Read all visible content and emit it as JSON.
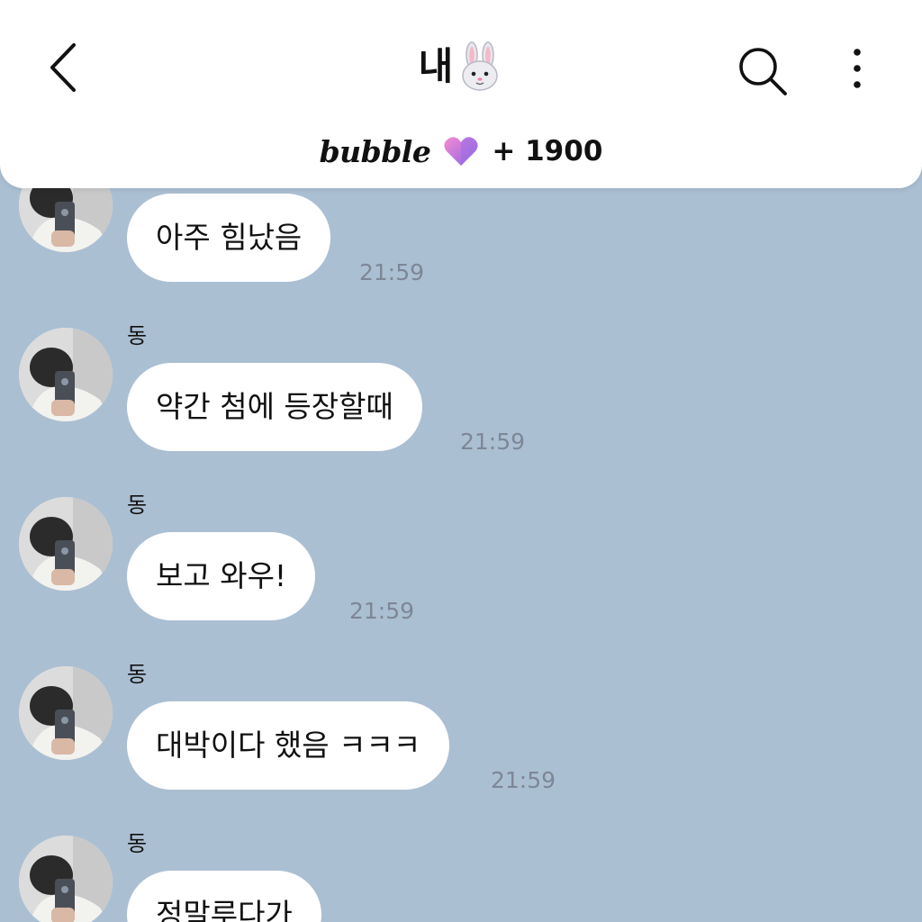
{
  "header": {
    "title": "내",
    "title_emoji": "rabbit-face-icon",
    "bubble_brand": "bubble",
    "bubble_count": "+ 1900",
    "icons": {
      "back": "back-chevron-icon",
      "search": "search-icon",
      "more": "more-vertical-icon",
      "heart": "heart-gradient-icon"
    }
  },
  "messages": [
    {
      "sender": "",
      "text": "아주 힘났음",
      "time": "21:59"
    },
    {
      "sender": "동",
      "text": "약간 첨에 등장할때",
      "time": "21:59"
    },
    {
      "sender": "동",
      "text": "보고 와우!",
      "time": "21:59"
    },
    {
      "sender": "동",
      "text": "대박이다 했음 ㅋㅋㅋ",
      "time": "21:59"
    },
    {
      "sender": "동",
      "text": "정말루다가",
      "time": ""
    }
  ],
  "colors": {
    "chat_background": "#abbfd3",
    "bubble_background": "#ffffff",
    "time_text": "#7d8796",
    "heart_pink": "#f58bd0",
    "heart_purple": "#8b63e8"
  }
}
